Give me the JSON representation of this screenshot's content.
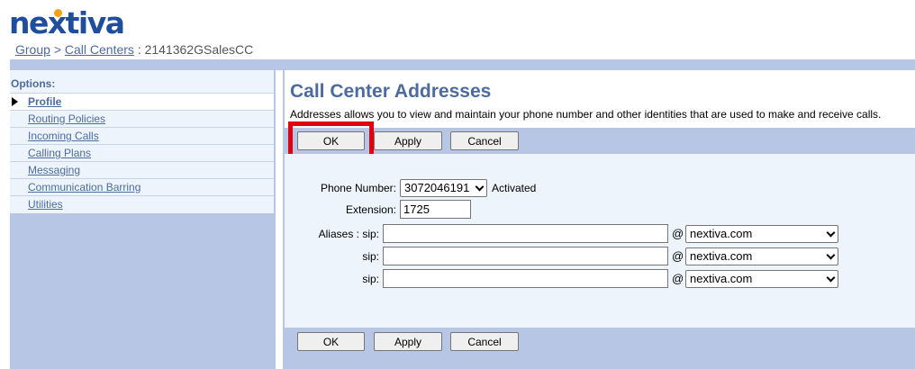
{
  "logo": {
    "text": "nextiva"
  },
  "breadcrumb": {
    "group": "Group",
    "sep": ">",
    "call_centers": "Call Centers",
    "current": ": 2141362GSalesCC"
  },
  "sidebar": {
    "title": "Options:",
    "items": [
      {
        "label": "Profile",
        "active": true
      },
      {
        "label": "Routing Policies"
      },
      {
        "label": "Incoming Calls"
      },
      {
        "label": "Calling Plans"
      },
      {
        "label": "Messaging"
      },
      {
        "label": "Communication Barring"
      },
      {
        "label": "Utilities"
      }
    ]
  },
  "main": {
    "title": "Call Center Addresses",
    "description": "Addresses allows you to view and maintain your phone number and other identities that are used to make and receive calls."
  },
  "buttons": {
    "ok": "OK",
    "apply": "Apply",
    "cancel": "Cancel"
  },
  "form": {
    "phone_label": "Phone Number:",
    "phone_value": "3072046191",
    "phone_status": "Activated",
    "extension_label": "Extension:",
    "extension_value": "1725",
    "aliases_label": "Aliases : sip:",
    "sip_label": "sip:",
    "at": "@",
    "domain": "nextiva.com",
    "aliases": [
      {
        "value": "",
        "domain": "nextiva.com"
      },
      {
        "value": "",
        "domain": "nextiva.com"
      },
      {
        "value": "",
        "domain": "nextiva.com"
      }
    ]
  },
  "colors": {
    "accent": "#4d6b9e",
    "band": "#b8c6e6",
    "panel": "#edf4fc",
    "highlight": "#e00010",
    "logo": "#1f4e9c",
    "logo_dot": "#f4a21a"
  }
}
